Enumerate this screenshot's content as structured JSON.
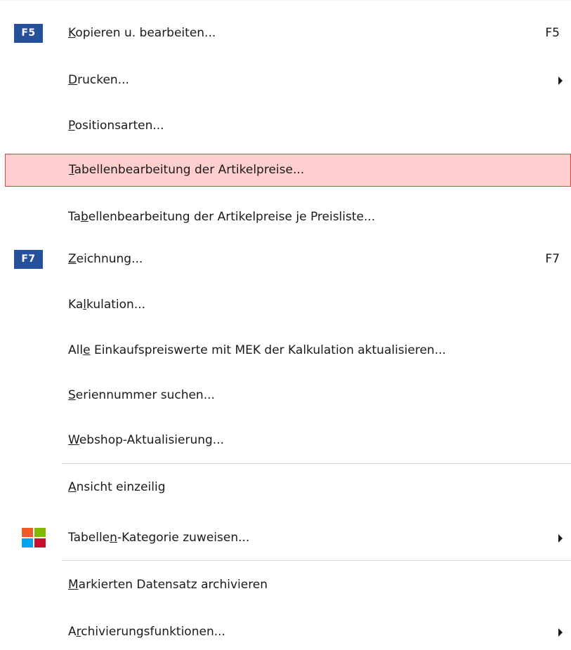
{
  "menu": {
    "items": [
      {
        "badge": "F5",
        "prefix": "",
        "acc": "K",
        "suffix": "opieren u. bearbeiten...",
        "shortcut": "F5"
      },
      {
        "badge": "",
        "prefix": "",
        "acc": "D",
        "suffix": "rucken...",
        "shortcut": ""
      },
      {
        "badge": "",
        "prefix": "",
        "acc": "P",
        "suffix": "ositionsarten...",
        "shortcut": ""
      },
      {
        "badge": "",
        "prefix": "",
        "acc": "T",
        "suffix": "abellenbearbeitung der Artikelpreise...",
        "shortcut": ""
      },
      {
        "badge": "",
        "prefix": "Ta",
        "acc": "b",
        "suffix": "ellenbearbeitung der Artikelpreise je Preisliste...",
        "shortcut": ""
      },
      {
        "badge": "F7",
        "prefix": "",
        "acc": "Z",
        "suffix": "eichnung...",
        "shortcut": "F7"
      },
      {
        "badge": "",
        "prefix": "Ka",
        "acc": "l",
        "suffix": "kulation...",
        "shortcut": ""
      },
      {
        "badge": "",
        "prefix": "All",
        "acc": "e",
        "suffix": " Einkaufspreiswerte mit MEK der Kalkulation aktualisieren...",
        "shortcut": ""
      },
      {
        "badge": "",
        "prefix": "",
        "acc": "S",
        "suffix": "eriennummer suchen...",
        "shortcut": ""
      },
      {
        "badge": "",
        "prefix": "",
        "acc": "W",
        "suffix": "ebshop-Aktualisierung...",
        "shortcut": ""
      },
      {
        "badge": "",
        "prefix": "",
        "acc": "A",
        "suffix": "nsicht einzeilig",
        "shortcut": ""
      },
      {
        "badge": "",
        "prefix": "Tabelle",
        "acc": "n",
        "suffix": "-Kategorie zuweisen...",
        "shortcut": ""
      },
      {
        "badge": "",
        "prefix": "",
        "acc": "M",
        "suffix": "arkierten Datensatz archivieren",
        "shortcut": ""
      },
      {
        "badge": "",
        "prefix": "A",
        "acc": "r",
        "suffix": "chivierungsfunktionen...",
        "shortcut": ""
      }
    ],
    "submenu_arrow_items": [
      1,
      11,
      13
    ],
    "highlighted_index": 3,
    "icons": {
      "badge-f5": "function-key-f5-icon",
      "badge-f7": "function-key-f7-icon",
      "category": "colored-tiles-icon",
      "submenu": "submenu-arrow-icon"
    },
    "colors": {
      "badge_bg": "#24509c",
      "highlight_bg": "#ffcfcf",
      "highlight_border": "#e84040",
      "tile_orange": "#f05a23",
      "tile_green": "#7fba00",
      "tile_blue": "#00a4ef",
      "tile_red": "#c8102e"
    }
  }
}
